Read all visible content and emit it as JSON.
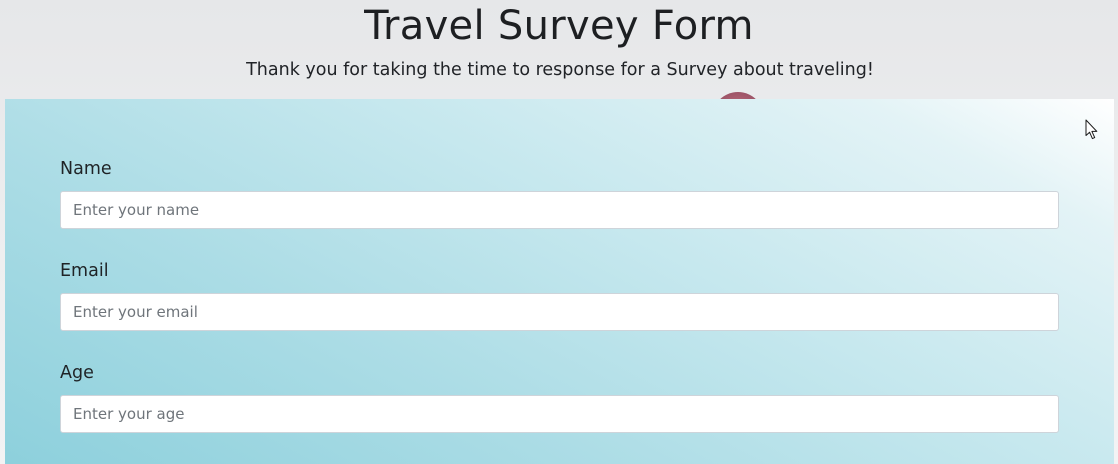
{
  "header": {
    "title": "Travel Survey Form",
    "description": "Thank you for taking the time to response for a Survey about traveling!"
  },
  "form": {
    "fields": [
      {
        "label": "Name",
        "placeholder": "Enter your name",
        "value": ""
      },
      {
        "label": "Email",
        "placeholder": "Enter your email",
        "value": ""
      },
      {
        "label": "Age",
        "placeholder": "Enter your age",
        "value": ""
      }
    ]
  },
  "icons": {
    "cursor": "mouse-pointer-icon"
  },
  "colors": {
    "page_background": "#eeeff0",
    "panel_gradient_start": "#ffffff",
    "panel_gradient_end": "#8dd0dc",
    "input_border": "#ced4da",
    "text": "#1f2326"
  }
}
